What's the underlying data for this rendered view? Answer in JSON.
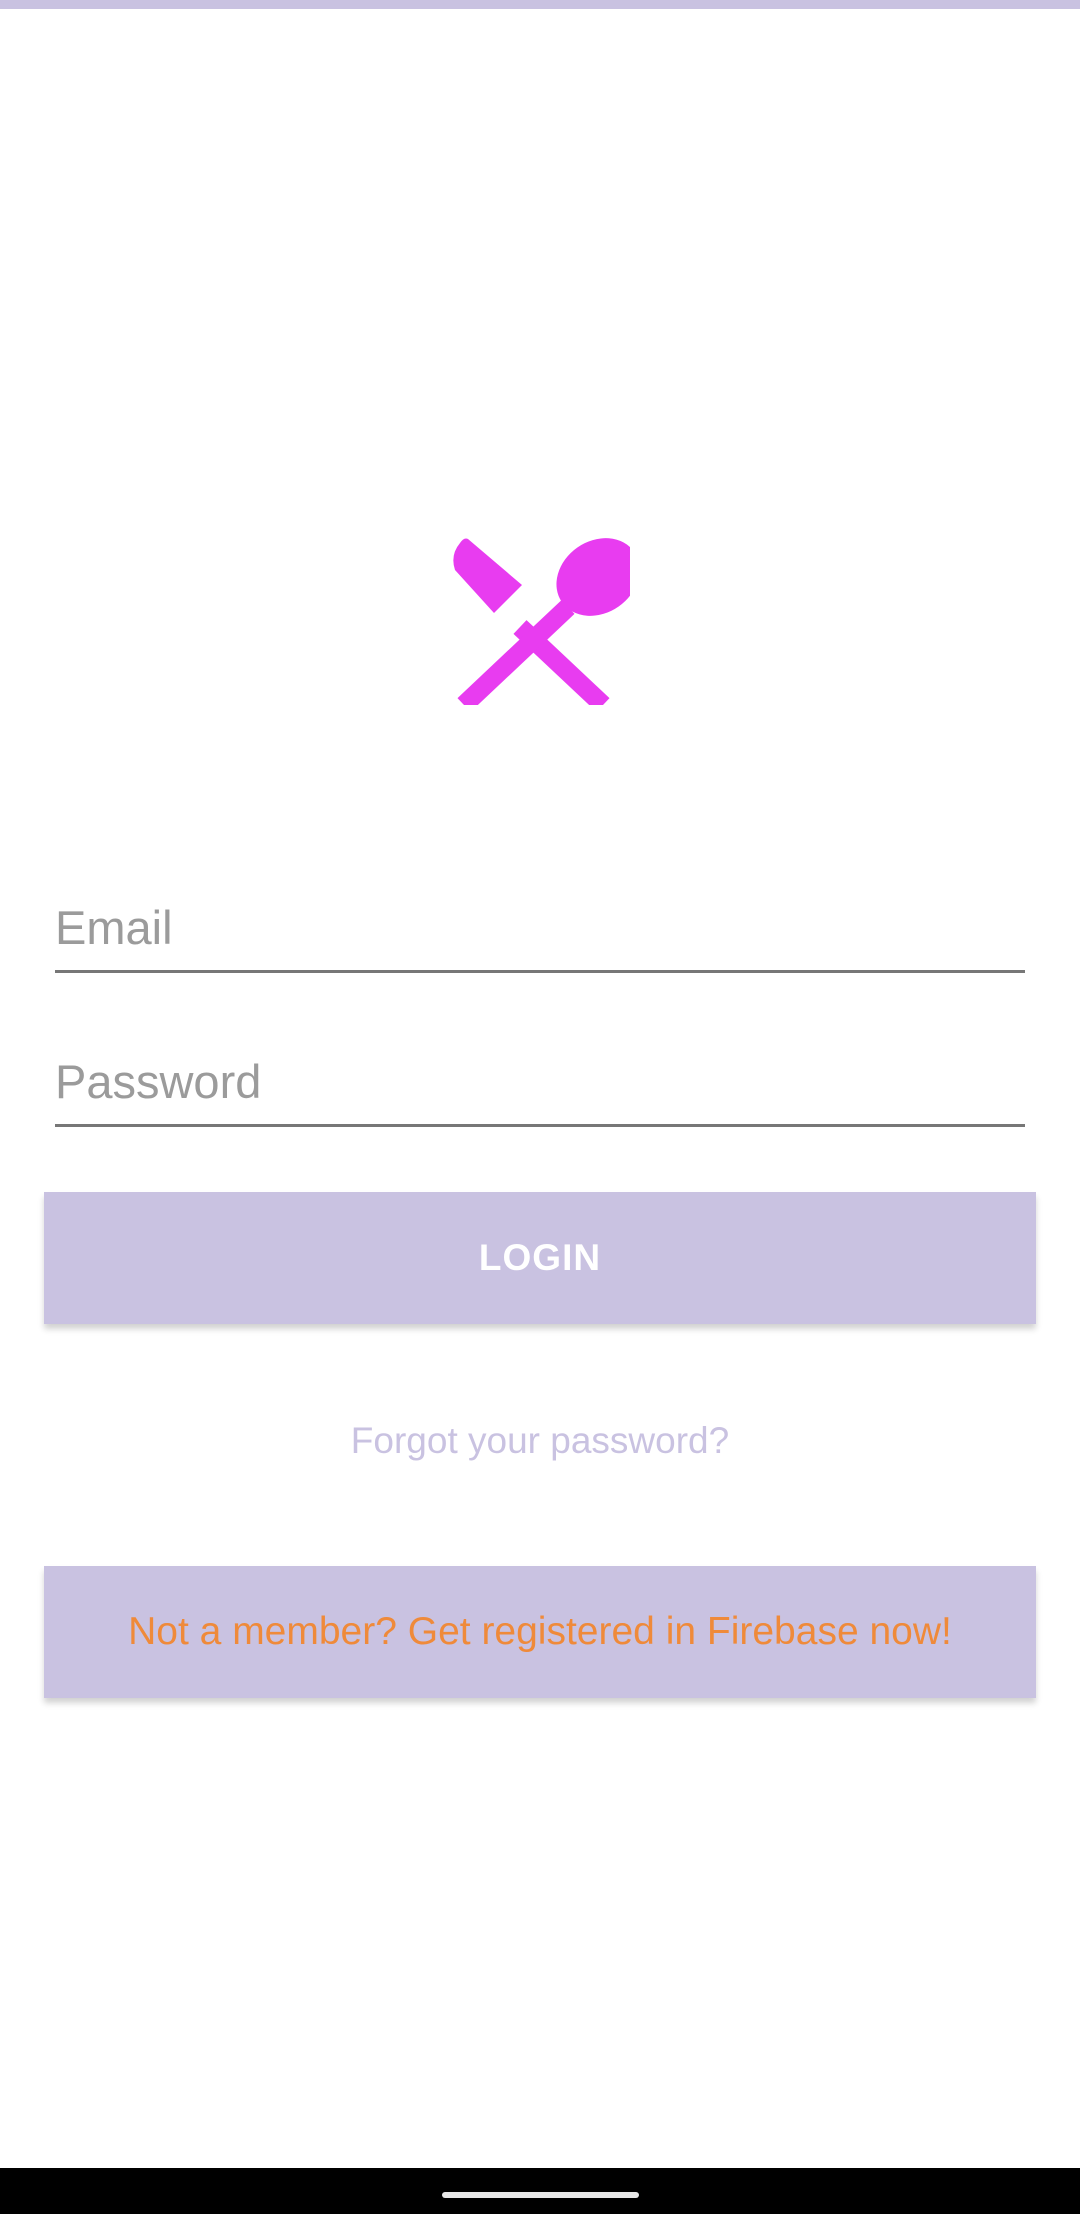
{
  "colors": {
    "accent": "#c9c2e1",
    "logo": "#e83cf0",
    "register_text": "#ef8a3a",
    "underline": "#777777"
  },
  "logo": {
    "icon": "fork-spoon-icon"
  },
  "email": {
    "placeholder": "Email",
    "value": ""
  },
  "password": {
    "placeholder": "Password",
    "value": ""
  },
  "login_button": {
    "label": "LOGIN"
  },
  "forgot_password": {
    "label": "Forgot your password?"
  },
  "register_button": {
    "label": "Not a member? Get registered in Firebase now!"
  }
}
